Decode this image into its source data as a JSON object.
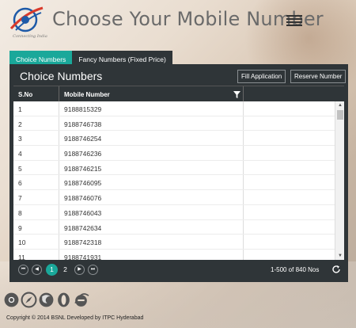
{
  "header": {
    "title": "Choose Your Mobile Number",
    "logo_tagline": "Connecting India"
  },
  "tabs": [
    {
      "label": "Choice Numbers",
      "active": true
    },
    {
      "label": "Fancy Numbers (Fixed Price)",
      "active": false
    }
  ],
  "panel": {
    "title": "Choice Numbers",
    "fill_button": "Fill Application",
    "reserve_button": "Reserve Number"
  },
  "grid": {
    "columns": [
      "S.No",
      "Mobile Number"
    ],
    "rows": [
      {
        "sno": "1",
        "mobile": "9188815329"
      },
      {
        "sno": "2",
        "mobile": "9188746738"
      },
      {
        "sno": "3",
        "mobile": "9188746254"
      },
      {
        "sno": "4",
        "mobile": "9188746236"
      },
      {
        "sno": "5",
        "mobile": "9188746215"
      },
      {
        "sno": "6",
        "mobile": "9188746095"
      },
      {
        "sno": "7",
        "mobile": "9188746076"
      },
      {
        "sno": "8",
        "mobile": "9188746043"
      },
      {
        "sno": "9",
        "mobile": "9188742634"
      },
      {
        "sno": "10",
        "mobile": "9188742318"
      },
      {
        "sno": "11",
        "mobile": "9188741931"
      }
    ]
  },
  "pager": {
    "pages": [
      "1",
      "2"
    ],
    "current": "1",
    "info": "1-500 of 840 Nos"
  },
  "footer": {
    "copyright": "Copyright © 2014 BSNL Developed by ITPC Hyderabad",
    "browser_icons": [
      "chrome-icon",
      "safari-icon",
      "firefox-icon",
      "opera-icon",
      "ie-icon"
    ]
  },
  "colors": {
    "accent": "#1aa89a",
    "panel_dark": "#2f3538"
  }
}
